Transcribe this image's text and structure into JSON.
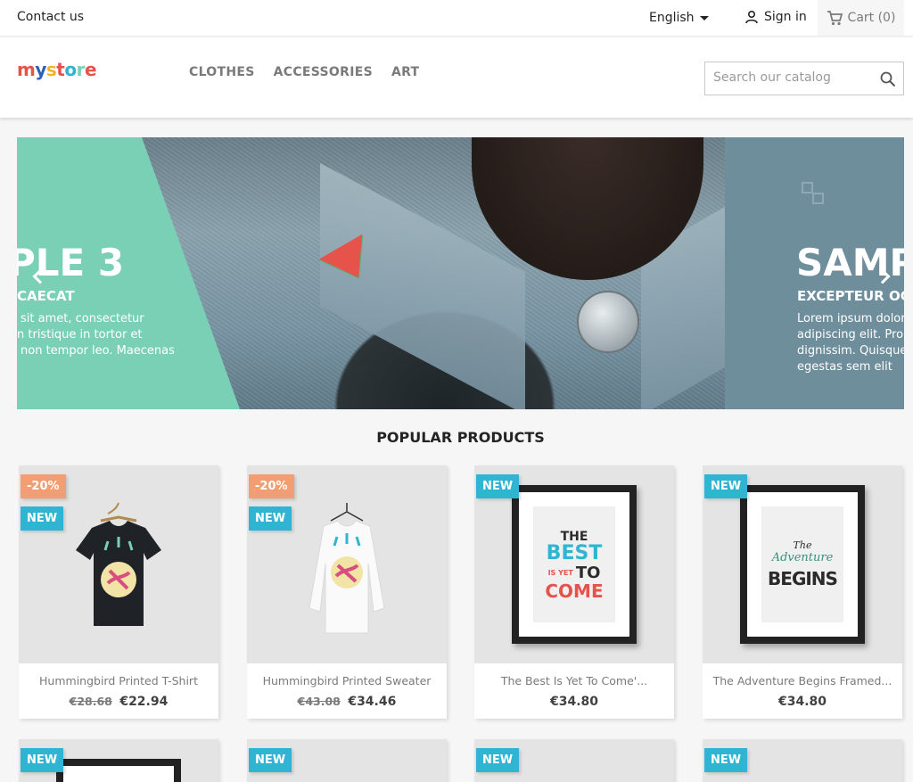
{
  "topbar": {
    "contact": "Contact us",
    "language": "English",
    "signin": "Sign in",
    "cart": "Cart (0)"
  },
  "header": {
    "logo": [
      "m",
      "y",
      " ",
      "s",
      "t",
      "o",
      "r",
      "e"
    ],
    "nav": [
      "CLOTHES",
      "ACCESSORIES",
      "ART"
    ],
    "search_placeholder": "Search our catalog"
  },
  "slider": {
    "left": {
      "title": "PLE 3",
      "subtitle": "CAECAT",
      "lines": [
        "sit amet, consectetur",
        "n tristique in tortor et",
        "non tempor leo. Maecenas"
      ]
    },
    "right": {
      "title": "SAMP",
      "subtitle": "EXCEPTEUR OCC",
      "lines": [
        "Lorem ipsum dolor",
        "adipiscing elit. Proi",
        "dignissim. Quisque",
        "egestas sem elit"
      ]
    }
  },
  "section_title": "POPULAR PRODUCTS",
  "products": [
    {
      "name": "Hummingbird Printed T-Shirt",
      "old_price": "€28.68",
      "price": "€22.94",
      "discount": "-20%",
      "flag": "NEW"
    },
    {
      "name": "Hummingbird Printed Sweater",
      "old_price": "€43.08",
      "price": "€34.46",
      "discount": "-20%",
      "flag": "NEW"
    },
    {
      "name": "The Best Is Yet To Come'...",
      "price": "€34.80",
      "flag": "NEW"
    },
    {
      "name": "The Adventure Begins Framed...",
      "price": "€34.80",
      "flag": "NEW"
    }
  ],
  "second_row_flags": [
    "NEW",
    "NEW",
    "NEW",
    "NEW"
  ],
  "poster_best": {
    "line1": "THE",
    "line2": "BEST",
    "line3a": "IS YET",
    "line3b": "TO",
    "line4": "COME"
  },
  "poster_adventure": {
    "line1": "The",
    "line2": "Adventure",
    "line3": "BEGINS"
  },
  "colors": {
    "accent": "#2fb5d2",
    "discount": "#f39d72",
    "mint": "#7ad0b5",
    "slate": "#6e8e9c"
  }
}
